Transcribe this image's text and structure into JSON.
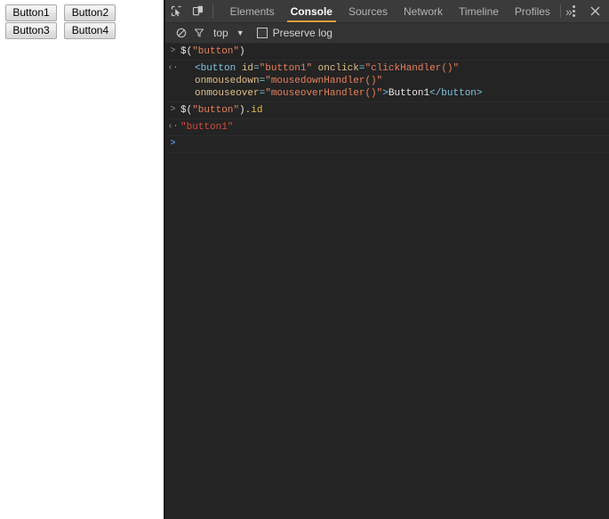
{
  "page": {
    "buttons": [
      {
        "label": "Button1"
      },
      {
        "label": "Button2"
      },
      {
        "label": "Button3"
      },
      {
        "label": "Button4"
      }
    ]
  },
  "devtools": {
    "toolbar": {
      "inspect_icon": "inspect-cursor-icon",
      "device_icon": "device-toolbar-icon",
      "more_tabs_label": "»",
      "kebab_icon": "more-options-icon",
      "close_icon": "close-icon",
      "tabs": [
        {
          "label": "Elements",
          "active": false
        },
        {
          "label": "Console",
          "active": true
        },
        {
          "label": "Sources",
          "active": false
        },
        {
          "label": "Network",
          "active": false
        },
        {
          "label": "Timeline",
          "active": false
        },
        {
          "label": "Profiles",
          "active": false
        }
      ],
      "active_tab": "Console",
      "accent_color": "#e8a33d"
    },
    "filterbar": {
      "clear_icon": "clear-console-icon",
      "filter_icon": "filter-funnel-icon",
      "context_label": "top",
      "context_caret": "▼",
      "preserve_log_label": "Preserve log",
      "preserve_log_checked": false
    },
    "console": {
      "entries": [
        {
          "type": "input",
          "gutter": ">",
          "tokens": [
            {
              "text": "$(",
              "cls": "tok-plain"
            },
            {
              "text": "\"button\"",
              "cls": "tok-string"
            },
            {
              "text": ")",
              "cls": "tok-plain"
            }
          ]
        },
        {
          "type": "output",
          "gutter": "‹·",
          "indent": true,
          "tokens": [
            {
              "text": "<button",
              "cls": "tok-tag"
            },
            {
              "text": " ",
              "cls": "tok-plain"
            },
            {
              "text": "id",
              "cls": "tok-attr"
            },
            {
              "text": "=",
              "cls": "tok-tag"
            },
            {
              "text": "\"button1\"",
              "cls": "tok-val"
            },
            {
              "text": " ",
              "cls": "tok-plain"
            },
            {
              "text": "onclick",
              "cls": "tok-attr"
            },
            {
              "text": "=",
              "cls": "tok-tag"
            },
            {
              "text": "\"clickHandler()\"",
              "cls": "tok-val"
            },
            {
              "text": " ",
              "cls": "tok-plain"
            },
            {
              "text": "onmousedown",
              "cls": "tok-attr"
            },
            {
              "text": "=",
              "cls": "tok-tag"
            },
            {
              "text": "\"mousedownHandler()\"",
              "cls": "tok-val"
            },
            {
              "text": " ",
              "cls": "tok-plain"
            },
            {
              "text": "onmouseover",
              "cls": "tok-attr"
            },
            {
              "text": "=",
              "cls": "tok-tag"
            },
            {
              "text": "\"mouseoverHandler()\"",
              "cls": "tok-val"
            },
            {
              "text": ">",
              "cls": "tok-tag"
            },
            {
              "text": "Button1",
              "cls": "tok-text"
            },
            {
              "text": "</button>",
              "cls": "tok-tag"
            }
          ]
        },
        {
          "type": "input",
          "gutter": ">",
          "tokens": [
            {
              "text": "$(",
              "cls": "tok-plain"
            },
            {
              "text": "\"button\"",
              "cls": "tok-string"
            },
            {
              "text": ")",
              "cls": "tok-plain"
            },
            {
              "text": ".id",
              "cls": "tok-prop"
            }
          ]
        },
        {
          "type": "output",
          "gutter": "‹·",
          "tokens": [
            {
              "text": "\"button1\"",
              "cls": "tok-result"
            }
          ]
        },
        {
          "type": "prompt",
          "gutter": ">",
          "tokens": []
        }
      ]
    }
  }
}
